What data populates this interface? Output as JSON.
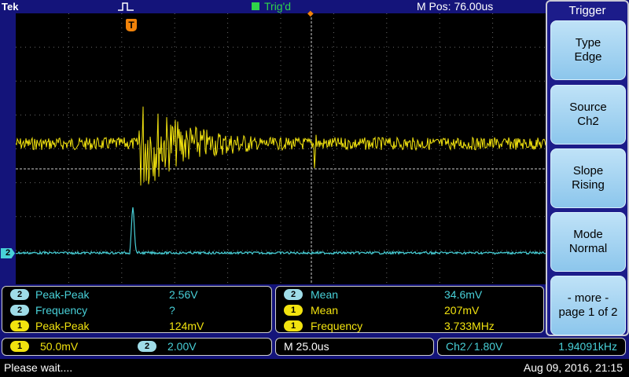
{
  "header": {
    "brand": "Tek",
    "trigger_status": "Trig'd",
    "position": "M Pos: 76.00us"
  },
  "markers": {
    "trigger_marker": "T",
    "ch2_reference": "2"
  },
  "measurements": {
    "left": [
      {
        "channel": "2",
        "name": "Peak-Peak",
        "value": "2.56V"
      },
      {
        "channel": "2",
        "name": "Frequency",
        "value": "?"
      },
      {
        "channel": "1",
        "name": "Peak-Peak",
        "value": "124mV"
      }
    ],
    "right": [
      {
        "channel": "2",
        "name": "Mean",
        "value": "34.6mV"
      },
      {
        "channel": "1",
        "name": "Mean",
        "value": "207mV"
      },
      {
        "channel": "1",
        "name": "Frequency",
        "value": "3.733MHz"
      }
    ]
  },
  "vertical": {
    "ch1_label": "1",
    "ch1_scale": "50.0mV",
    "ch2_label": "2",
    "ch2_scale": "2.00V"
  },
  "horizontal": {
    "timebase": "M 25.0us"
  },
  "trigger_readout": {
    "source_level": "Ch2 ⁄ 1.80V",
    "frequency": "1.94091kHz"
  },
  "footer": {
    "message": "Please wait....",
    "datetime": "Aug 09, 2016, 21:15"
  },
  "side_menu": {
    "title": "Trigger",
    "buttons": [
      {
        "line1": "Type",
        "line2": "Edge"
      },
      {
        "line1": "Source",
        "line2": "Ch2"
      },
      {
        "line1": "Slope",
        "line2": "Rising"
      },
      {
        "line1": "Mode",
        "line2": "Normal"
      },
      {
        "line1": "- more -",
        "line2": "page 1 of 2"
      }
    ]
  },
  "colors": {
    "background": "#14147a",
    "ch1": "#f2e30f",
    "ch2": "#48d0d8",
    "trigger": "#f0820a",
    "triggered": "#2fd44a"
  }
}
